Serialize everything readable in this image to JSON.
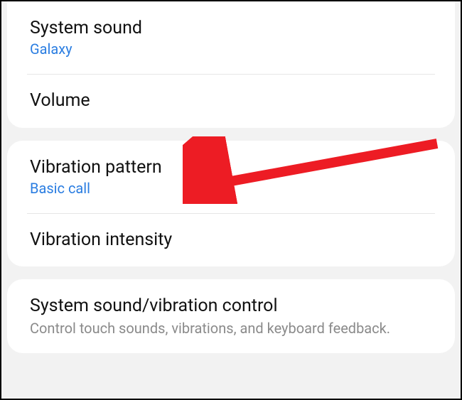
{
  "group1": {
    "items": [
      {
        "title": "System sound",
        "sub": "Galaxy"
      },
      {
        "title": "Volume"
      }
    ]
  },
  "group2": {
    "items": [
      {
        "title": "Vibration pattern",
        "sub": "Basic call"
      },
      {
        "title": "Vibration intensity"
      }
    ]
  },
  "group3": {
    "items": [
      {
        "title": "System sound/vibration control",
        "desc": "Control touch sounds, vibrations, and keyboard feedback."
      }
    ]
  },
  "annotation": {
    "color": "#ed1c24"
  }
}
